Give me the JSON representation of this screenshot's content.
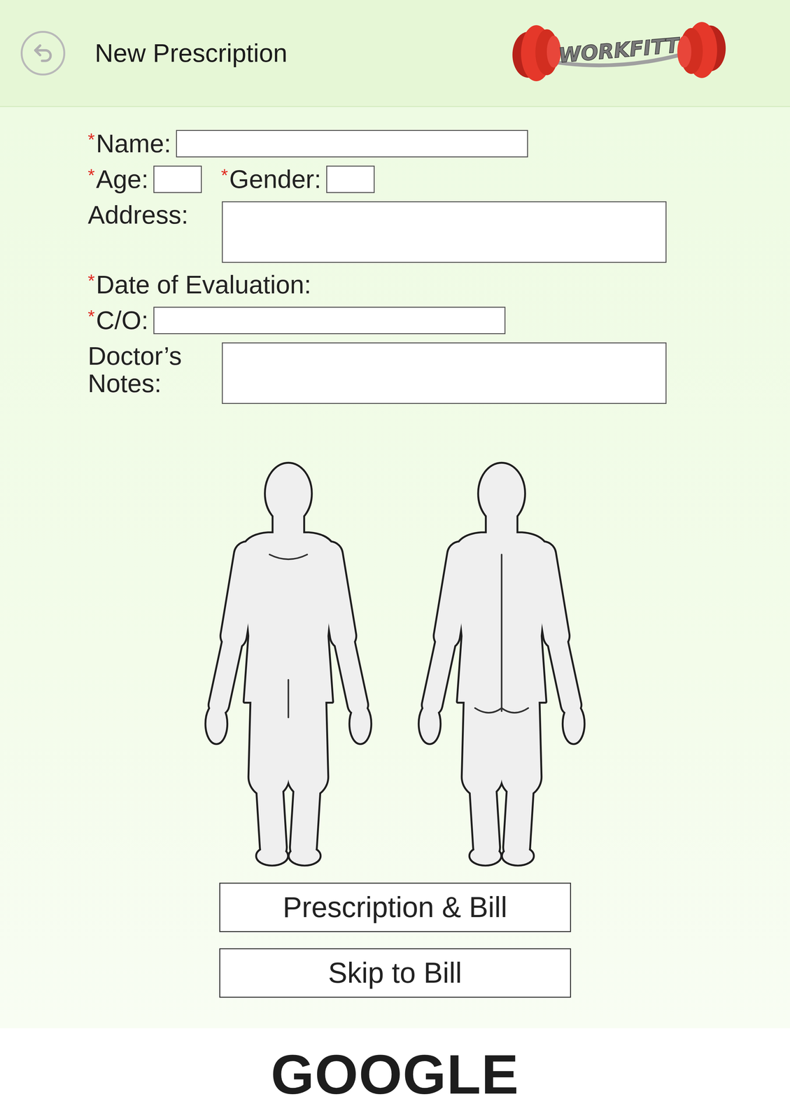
{
  "header": {
    "title": "New Prescription",
    "logo": "WORKFITT"
  },
  "required_mark": "*",
  "form": {
    "rows": [
      {
        "fields": [
          {
            "label": "Name:",
            "required": true,
            "kind": "long"
          }
        ]
      },
      {
        "fields": [
          {
            "label": "Age:",
            "required": true,
            "kind": "short"
          },
          {
            "label": "Gender:",
            "required": true,
            "kind": "short"
          }
        ]
      },
      {
        "fields": [
          {
            "label": "Address:",
            "required": false,
            "kind": "area"
          }
        ]
      },
      {
        "fields": [
          {
            "label": "Date of Evaluation:",
            "required": true,
            "kind": "none"
          }
        ]
      },
      {
        "fields": [
          {
            "label": "C/O:",
            "required": true,
            "kind": "long"
          }
        ]
      },
      {
        "fields": [
          {
            "label": "Doctor’s Notes:",
            "required": false,
            "kind": "area"
          }
        ]
      }
    ]
  },
  "body_chart": {
    "views": [
      {
        "kind": "front"
      },
      {
        "kind": "back"
      }
    ]
  },
  "buttons": [
    "Prescription & Bill",
    "Skip to Bill"
  ],
  "footer": {
    "brand": "GOOGLE"
  }
}
